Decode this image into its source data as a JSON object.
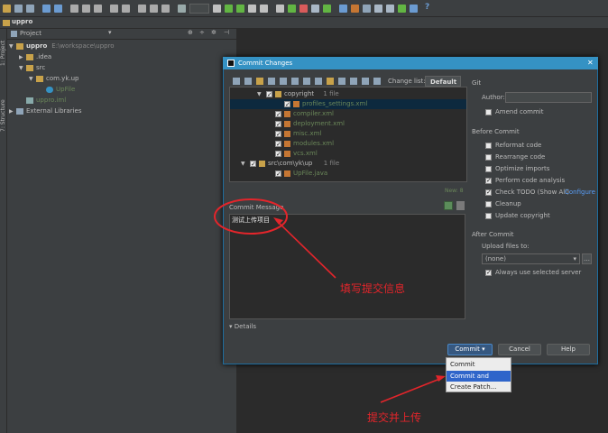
{
  "toolbar": {
    "run_config": "",
    "help": "?"
  },
  "navbar": {
    "project": "uppro"
  },
  "side_tabs": {
    "project": "1: Project",
    "structure": "7: Structure"
  },
  "project_panel": {
    "view_label": "Project",
    "tree": [
      {
        "label": "uppro",
        "path": "E:\\workspace\\uppro",
        "indent": 0,
        "arrow": "▼",
        "icon": "module-folder-icon"
      },
      {
        "label": ".idea",
        "indent": 1,
        "arrow": "▶",
        "icon": "folder-icon"
      },
      {
        "label": "src",
        "indent": 1,
        "arrow": "▼",
        "icon": "folder-icon"
      },
      {
        "label": "com.yk.up",
        "indent": 2,
        "arrow": "▼",
        "icon": "package-icon"
      },
      {
        "label": "UpFile",
        "indent": 3,
        "arrow": "",
        "icon": "class-icon"
      },
      {
        "label": "uppro.iml",
        "indent": 1,
        "arrow": "",
        "icon": "iml-icon"
      },
      {
        "label": "External Libraries",
        "indent": 0,
        "arrow": "▶",
        "icon": "library-icon"
      }
    ]
  },
  "dialog": {
    "title": "Commit Changes",
    "change_list_label": "Change list:",
    "change_list_value": "Default",
    "git_label": "Git",
    "author_label": "Author:",
    "amend_label": "Amend commit",
    "before_commit_label": "Before Commit",
    "before_commit_options": [
      {
        "label": "Reformat code",
        "checked": false
      },
      {
        "label": "Rearrange code",
        "checked": false
      },
      {
        "label": "Optimize imports",
        "checked": false
      },
      {
        "label": "Perform code analysis",
        "checked": true
      },
      {
        "label": "Check TODO (Show All)",
        "checked": true,
        "link": "Configure"
      },
      {
        "label": "Cleanup",
        "checked": false
      },
      {
        "label": "Update copyright",
        "checked": false
      }
    ],
    "after_commit_label": "After Commit",
    "upload_label": "Upload files to:",
    "upload_value": "(none)",
    "always_use_label": "Always use selected server",
    "files": [
      {
        "label": "copyright",
        "count": "1 file",
        "indent": 0,
        "arrow": "▼",
        "folder": true,
        "color": "#bbbbbb"
      },
      {
        "label": "profiles_settings.xml",
        "indent": 2,
        "folder": false,
        "color": "#6a8759",
        "selected": true
      },
      {
        "label": "compiler.xml",
        "indent": 1,
        "folder": false,
        "color": "#6a8759"
      },
      {
        "label": "deployment.xml",
        "indent": 1,
        "folder": false,
        "color": "#6a8759"
      },
      {
        "label": "misc.xml",
        "indent": 1,
        "folder": false,
        "color": "#6a8759"
      },
      {
        "label": "modules.xml",
        "indent": 1,
        "folder": false,
        "color": "#6a8759"
      },
      {
        "label": "vcs.xml",
        "indent": 1,
        "folder": false,
        "color": "#6a8759"
      },
      {
        "label": "src\\com\\yk\\up",
        "count": "1 file",
        "indent": -1,
        "arrow": "▼",
        "folder": true,
        "color": "#bbbbbb"
      },
      {
        "label": "UpFile.java",
        "indent": 1,
        "folder": false,
        "color": "#6a8759"
      }
    ],
    "new_count": "New: 8",
    "commit_message_label": "Commit Message",
    "commit_message": "测试上传项目",
    "details_label": "Details",
    "commit_button": "Commit",
    "cancel_button": "Cancel",
    "help_button": "Help"
  },
  "commit_menu": [
    "Commit",
    "Commit and Push...",
    "Create Patch..."
  ],
  "annotations": {
    "fill_message": "填写提交信息",
    "commit_push": "提交并上传"
  },
  "colors": {
    "accent": "#3592c4",
    "annotation": "#e3252b",
    "added_file": "#6a8759"
  }
}
